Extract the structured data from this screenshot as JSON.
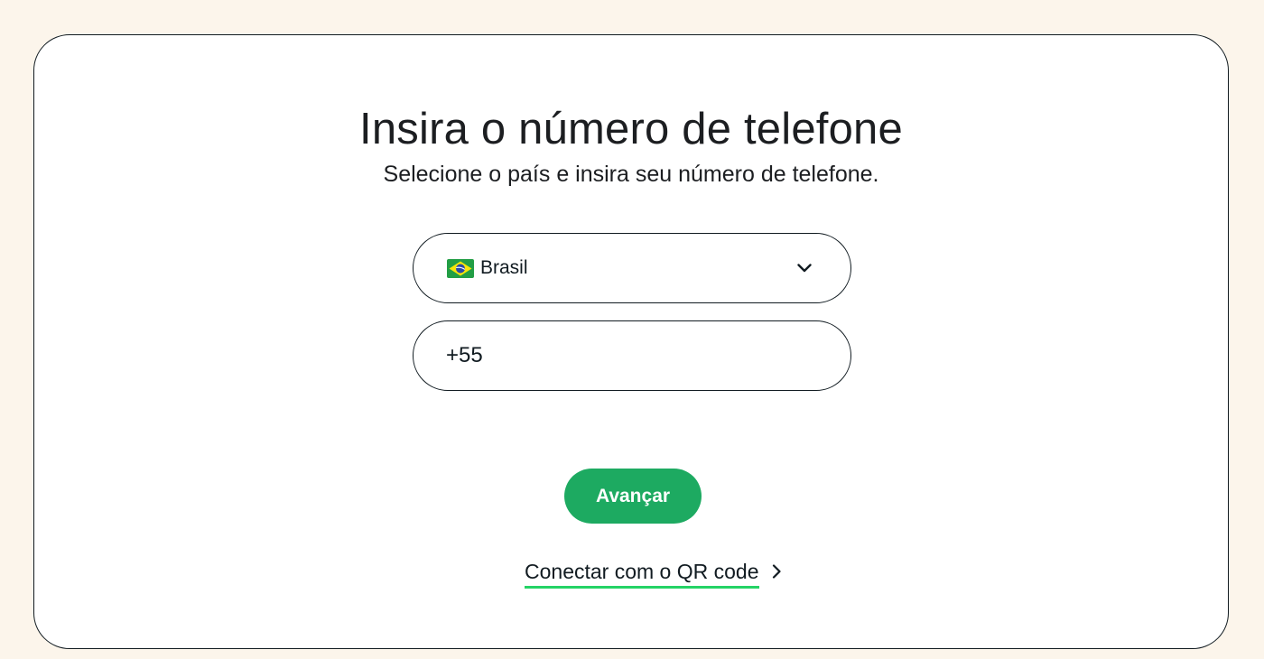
{
  "header": {
    "title": "Insira o número de telefone",
    "subtitle": "Selecione o país e insira seu número de telefone."
  },
  "country_select": {
    "flag_icon": "brazil-flag-icon",
    "selected_country": "Brasil",
    "dropdown_icon": "chevron-down-icon"
  },
  "phone_field": {
    "value": "+55"
  },
  "actions": {
    "next_label": "Avançar",
    "qr_link_label": "Conectar com o QR code",
    "qr_link_icon": "chevron-right-icon"
  },
  "colors": {
    "page_background": "#fcf5eb",
    "card_background": "#ffffff",
    "primary_button": "#1daa61",
    "link_underline": "#25d366",
    "text": "#1c1e21"
  }
}
